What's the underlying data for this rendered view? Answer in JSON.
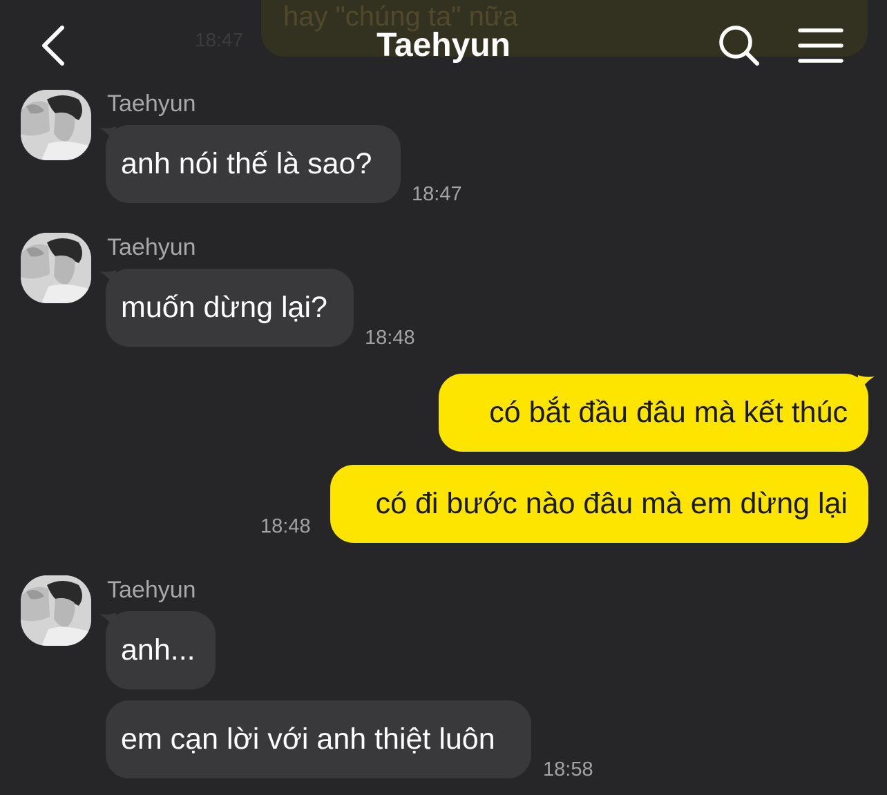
{
  "header": {
    "title": "Taehyun",
    "back_icon": "chevron-left-icon",
    "search_icon": "search-icon",
    "menu_icon": "hamburger-menu-icon",
    "text_color": "#ffffff"
  },
  "previous_message": {
    "text": "hay \"chúng ta\" nữa",
    "time": "18:47"
  },
  "colors": {
    "background": "#262628",
    "incoming_bubble": "#39393c",
    "outgoing_bubble": "#fee500",
    "timestamp": "#a3a3a6",
    "sender_name": "#a8a8ab"
  },
  "messages": [
    {
      "direction": "incoming",
      "sender": "Taehyun",
      "text": "anh nói thế là sao?",
      "time": "18:47"
    },
    {
      "direction": "incoming",
      "sender": "Taehyun",
      "text": "muốn dừng lại?",
      "time": "18:48"
    },
    {
      "direction": "outgoing",
      "text": "có bắt đầu đâu mà kết thúc",
      "time": ""
    },
    {
      "direction": "outgoing",
      "text": "có đi bước nào đâu mà em dừng lại",
      "time": "18:48"
    },
    {
      "direction": "incoming",
      "sender": "Taehyun",
      "text": "anh...",
      "time": ""
    },
    {
      "direction": "incoming",
      "sender": "",
      "text": "em cạn lời với anh thiệt luôn",
      "time": "18:58"
    }
  ]
}
